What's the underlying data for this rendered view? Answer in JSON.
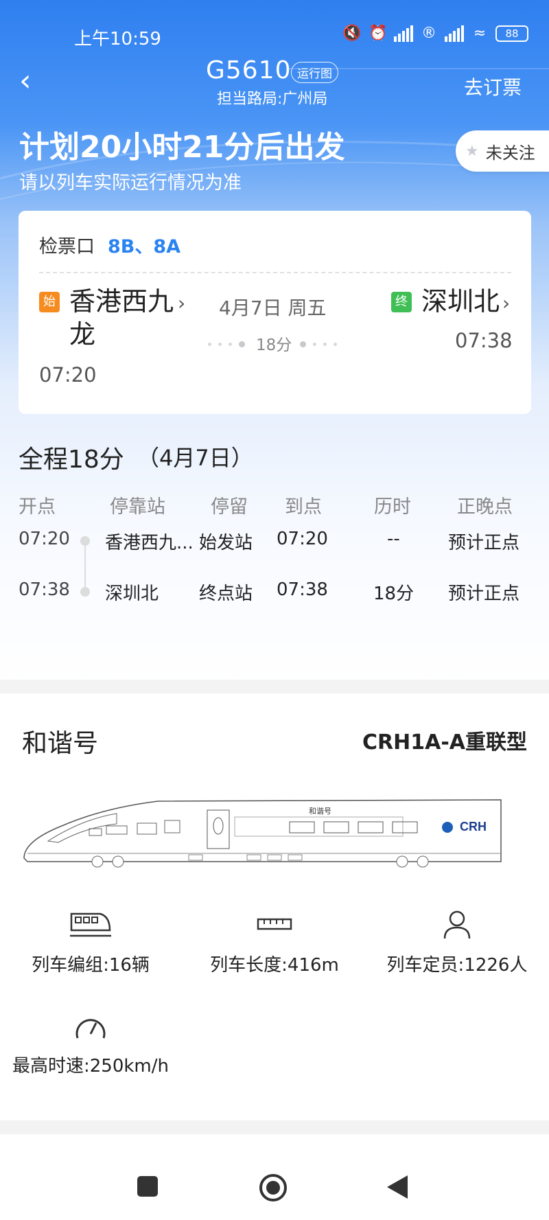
{
  "status_bar": {
    "time": "上午10:59",
    "battery": "88"
  },
  "header": {
    "train_no": "G5610",
    "run_chart_label": "运行图",
    "bureau": "担当路局:广州局",
    "book_label": "去订票"
  },
  "banner": {
    "countdown": "计划20小时21分后出发",
    "note": "请以列车实际运行情况为准",
    "follow_label": "未关注"
  },
  "trip_card": {
    "gate_label": "检票口",
    "gate_value": "8B、8A",
    "start_badge": "始",
    "end_badge": "终",
    "from_station": "香港西九龙",
    "from_time": "07:20",
    "date": "4月7日 周五",
    "duration": "18分",
    "to_station": "深圳北",
    "to_time": "07:38"
  },
  "schedule": {
    "total": "全程18分",
    "total_date": "（4月7日）",
    "headers": [
      "开点",
      "停靠站",
      "停留",
      "到点",
      "历时",
      "正晚点"
    ],
    "rows": [
      {
        "depart": "07:20",
        "station": "香港西九...",
        "stop": "始发站",
        "arrive": "07:20",
        "elapsed": "--",
        "status": "预计正点"
      },
      {
        "depart": "07:38",
        "station": "深圳北",
        "stop": "终点站",
        "arrive": "07:38",
        "elapsed": "18分",
        "status": "预计正点"
      }
    ]
  },
  "train_info": {
    "name": "和谐号",
    "model": "CRH1A-A重联型",
    "logo_text": "CRH",
    "body_text": "和谐号",
    "specs": {
      "cars": "列车编组:16辆",
      "length": "列车长度:416m",
      "capacity": "列车定员:1226人",
      "speed": "最高时速:250km/h"
    }
  },
  "colors": {
    "accent": "#2a83f2",
    "start_badge": "#f68b1f",
    "end_badge": "#3fbf55"
  }
}
